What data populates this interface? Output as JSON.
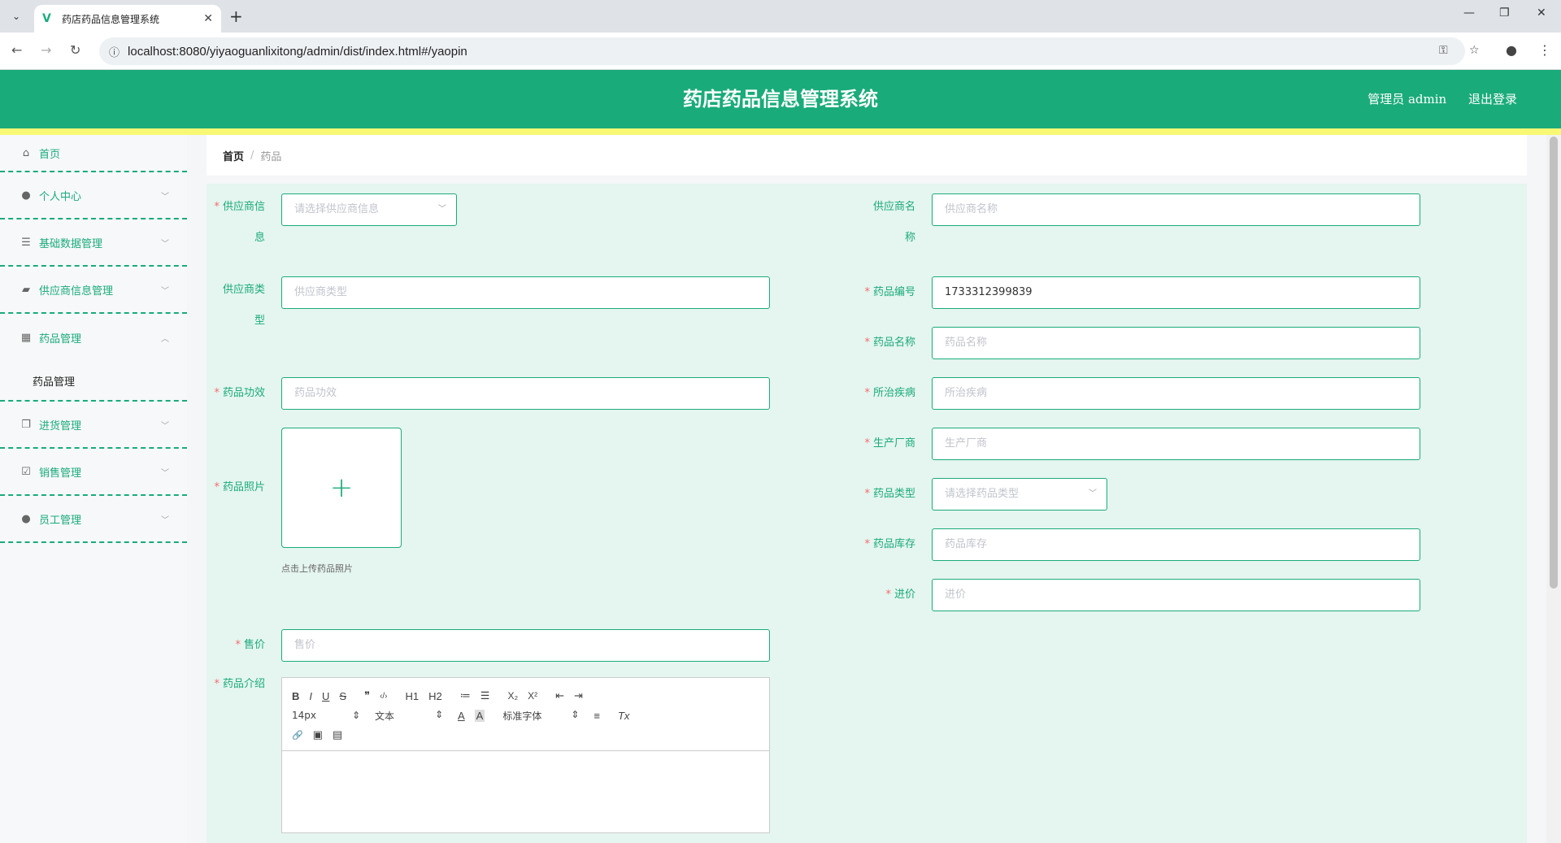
{
  "browser": {
    "tab_title": "药店药品信息管理系统",
    "url": "localhost:8080/yiyaoguanlixitong/admin/dist/index.html#/yaopin"
  },
  "header": {
    "title": "药店药品信息管理系统",
    "user": "管理员 admin",
    "logout": "退出登录"
  },
  "sidebar": {
    "items": [
      {
        "label": "首页",
        "icon": "home-icon"
      },
      {
        "label": "个人中心",
        "icon": "user-icon"
      },
      {
        "label": "基础数据管理",
        "icon": "list-icon"
      },
      {
        "label": "供应商信息管理",
        "icon": "briefcase-icon"
      },
      {
        "label": "药品管理",
        "icon": "grid-icon"
      },
      {
        "label": "进货管理",
        "icon": "copy-icon"
      },
      {
        "label": "销售管理",
        "icon": "clipboard-icon"
      },
      {
        "label": "员工管理",
        "icon": "user-icon"
      }
    ],
    "sub": "药品管理"
  },
  "breadcrumb": {
    "home": "首页",
    "sep": "/",
    "current": "药品"
  },
  "form": {
    "supplier_info": {
      "label1": "供应商信",
      "label2": "息",
      "placeholder": "请选择供应商信息"
    },
    "supplier_name": {
      "label1": "供应商名",
      "label2": "称",
      "placeholder": "供应商名称"
    },
    "supplier_type": {
      "label1": "供应商类",
      "label2": "型",
      "placeholder": "供应商类型"
    },
    "drug_code": {
      "label": "药品编号",
      "value": "1733312399839"
    },
    "drug_name": {
      "label": "药品名称",
      "placeholder": "药品名称"
    },
    "drug_effect": {
      "label": "药品功效",
      "placeholder": "药品功效"
    },
    "disease": {
      "label": "所治疾病",
      "placeholder": "所治疾病"
    },
    "manufacturer": {
      "label": "生产厂商",
      "placeholder": "生产厂商"
    },
    "drug_photo": {
      "label": "药品照片",
      "plus": "+",
      "tip": "点击上传药品照片"
    },
    "drug_type": {
      "label": "药品类型",
      "placeholder": "请选择药品类型"
    },
    "stock": {
      "label": "药品库存",
      "placeholder": "药品库存"
    },
    "purchase_price": {
      "label": "进价",
      "placeholder": "进价"
    },
    "sale_price": {
      "label": "售价",
      "placeholder": "售价"
    },
    "description": {
      "label": "药品介绍"
    },
    "required_mark": "*"
  },
  "editor": {
    "row1": [
      "B",
      "I",
      "U",
      "S",
      "❞",
      "‹/›",
      "H1",
      "H2",
      "≔",
      "☰",
      "X₂",
      "X²",
      "⇤",
      "⇥"
    ],
    "font_size": "14px",
    "text_style": "文本",
    "font_family": "标准字体",
    "select_arrow": "⇕",
    "color_a": "A",
    "bg_a": "A",
    "align": "≡",
    "clear": "Tx",
    "row3": [
      "🔗",
      "▣",
      "▤"
    ]
  }
}
